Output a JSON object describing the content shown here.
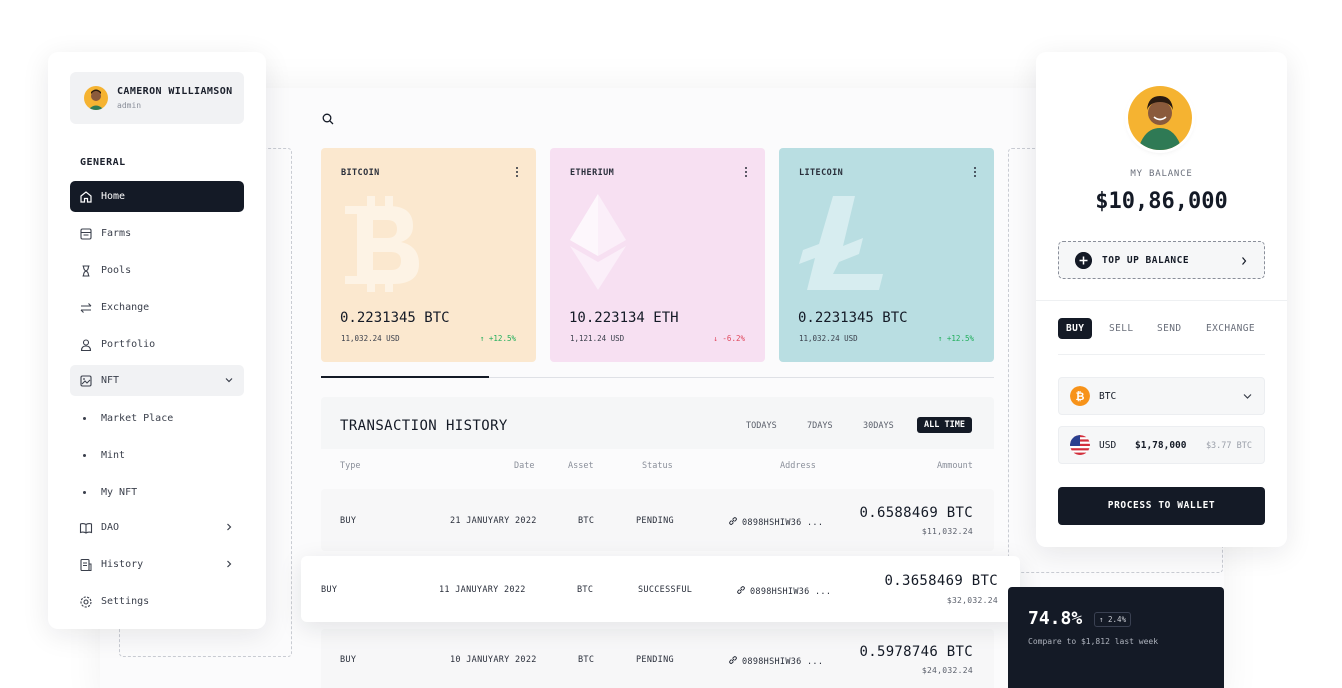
{
  "user": {
    "name": "CAMERON WILLIAMSON",
    "role": "admin"
  },
  "sidebar": {
    "section_label": "GENERAL",
    "items": [
      {
        "label": "Home",
        "icon": "home-icon"
      },
      {
        "label": "Farms",
        "icon": "farm-icon"
      },
      {
        "label": "Pools",
        "icon": "hourglass-icon"
      },
      {
        "label": "Exchange",
        "icon": "exchange-icon"
      },
      {
        "label": "Portfolio",
        "icon": "user-icon"
      },
      {
        "label": "NFT",
        "icon": "image-icon"
      },
      {
        "label": "DAO",
        "icon": "book-icon"
      },
      {
        "label": "History",
        "icon": "history-icon"
      },
      {
        "label": "Settings",
        "icon": "gear-icon"
      }
    ],
    "nft_sub": [
      "Market Place",
      "Mint",
      "My NFT"
    ]
  },
  "coins": [
    {
      "name": "BITCOIN",
      "amount": "0.2231345 BTC",
      "usd": "11,032.24 USD",
      "change": "↑ +12.5%",
      "direction": "up",
      "bg": "#fbe8cf",
      "glyph_color": "#fdf3e5"
    },
    {
      "name": "ETHERIUM",
      "amount": "10.223134 ETH",
      "usd": "1,121.24 USD",
      "change": "↓ -6.2%",
      "direction": "down",
      "bg": "#f7e0f2",
      "glyph_color": "#fbeff9"
    },
    {
      "name": "LITECOIN",
      "amount": "0.2231345 BTC",
      "usd": "11,032.24 USD",
      "change": "↑ +12.5%",
      "direction": "up",
      "bg": "#b9dee2",
      "glyph_color": "#d7edf0"
    }
  ],
  "transactions": {
    "title": "TRANSACTION HISTORY",
    "filters": [
      "TODAYS",
      "7DAYS",
      "30DAYS",
      "ALL TIME"
    ],
    "active_filter": "ALL TIME",
    "columns": [
      "Type",
      "Date",
      "Asset",
      "Status",
      "Address",
      "Ammount"
    ],
    "rows": [
      {
        "type": "BUY",
        "date": "21 JANUYARY 2022",
        "asset": "BTC",
        "status": "PENDING",
        "address": "0898HSHIW36 ...",
        "amount": "0.6588469 BTC",
        "usd": "$11,032.24"
      },
      {
        "type": "BUY",
        "date": "11 JANUYARY 2022",
        "asset": "BTC",
        "status": "SUCCESSFUL",
        "address": "0898HSHIW36 ...",
        "amount": "0.3658469 BTC",
        "usd": "$32,032.24"
      },
      {
        "type": "BUY",
        "date": "10 JANUYARY 2022",
        "asset": "BTC",
        "status": "PENDING",
        "address": "0898HSHIW36 ...",
        "amount": "0.5978746 BTC",
        "usd": "$24,032.24"
      }
    ]
  },
  "wallet": {
    "balance_label": "MY BALANCE",
    "balance": "$10,86,000",
    "topup_label": "TOP UP BALANCE",
    "tabs": [
      "BUY",
      "SELL",
      "SEND",
      "EXCHANGE"
    ],
    "asset": "BTC",
    "currency": "USD",
    "currency_amount": "$1,78,000",
    "converted": "$3.77 BTC",
    "process_label": "PROCESS TO WALLET"
  },
  "stat": {
    "percent": "74.8%",
    "badge": "↑ 2.4%",
    "compare": "Compare to $1,812 last week"
  },
  "colors": {
    "dark": "#141a26",
    "up": "#1fae5a",
    "down": "#e0465b",
    "avatar": "#f5b331",
    "btc_orange": "#f7931a"
  }
}
